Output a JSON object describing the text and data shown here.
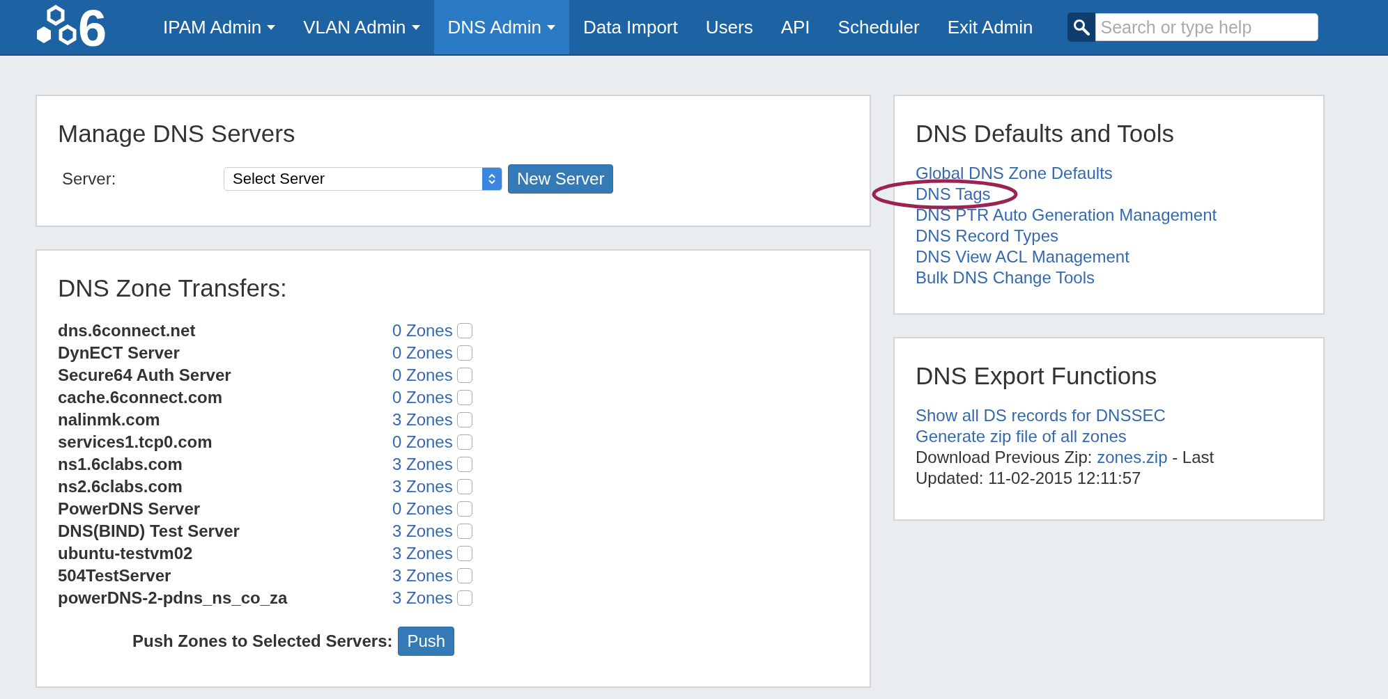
{
  "navbar": {
    "logo_text": "6",
    "items": [
      {
        "label": "IPAM Admin",
        "dropdown": true,
        "selected": false
      },
      {
        "label": "VLAN Admin",
        "dropdown": true,
        "selected": false
      },
      {
        "label": "DNS Admin",
        "dropdown": true,
        "selected": true
      },
      {
        "label": "Data Import",
        "dropdown": false,
        "selected": false
      },
      {
        "label": "Users",
        "dropdown": false,
        "selected": false
      },
      {
        "label": "API",
        "dropdown": false,
        "selected": false
      },
      {
        "label": "Scheduler",
        "dropdown": false,
        "selected": false
      },
      {
        "label": "Exit Admin",
        "dropdown": false,
        "selected": false
      }
    ],
    "search": {
      "placeholder": "Search or type help"
    }
  },
  "manage_servers": {
    "title": "Manage DNS Servers",
    "server_label": "Server:",
    "server_select": "Select Server",
    "new_button": "New Server"
  },
  "zone_transfers": {
    "title": "DNS Zone Transfers:",
    "rows": [
      {
        "server": "dns.6connect.net",
        "zones": "0 Zones",
        "checked": false
      },
      {
        "server": "DynECT Server",
        "zones": "0 Zones",
        "checked": false
      },
      {
        "server": "Secure64 Auth Server",
        "zones": "0 Zones",
        "checked": false
      },
      {
        "server": "cache.6connect.com",
        "zones": "0 Zones",
        "checked": false
      },
      {
        "server": "nalinmk.com",
        "zones": "3 Zones",
        "checked": false
      },
      {
        "server": "services1.tcp0.com",
        "zones": "0 Zones",
        "checked": false
      },
      {
        "server": "ns1.6clabs.com",
        "zones": "3 Zones",
        "checked": false
      },
      {
        "server": "ns2.6clabs.com",
        "zones": "3 Zones",
        "checked": false
      },
      {
        "server": "PowerDNS Server",
        "zones": "0 Zones",
        "checked": false
      },
      {
        "server": "DNS(BIND) Test Server",
        "zones": "3 Zones",
        "checked": false
      },
      {
        "server": "ubuntu-testvm02",
        "zones": "3 Zones",
        "checked": false
      },
      {
        "server": "504TestServer",
        "zones": "3 Zones",
        "checked": false
      },
      {
        "server": "powerDNS-2-pdns_ns_co_za",
        "zones": "3 Zones",
        "checked": false
      }
    ],
    "push_label": "Push Zones to Selected Servers:",
    "push_button": "Push"
  },
  "defaults_tools": {
    "title": "DNS Defaults and Tools",
    "links": [
      {
        "label": "Global DNS Zone Defaults",
        "circled": false
      },
      {
        "label": "DNS Tags",
        "circled": true
      },
      {
        "label": "DNS PTR Auto Generation Management",
        "circled": false
      },
      {
        "label": "DNS Record Types",
        "circled": false
      },
      {
        "label": "DNS View ACL Management",
        "circled": false
      },
      {
        "label": "Bulk DNS Change Tools",
        "circled": false
      }
    ]
  },
  "export_functions": {
    "title": "DNS Export Functions",
    "links": [
      "Show all DS records for DNSSEC",
      "Generate zip file of all zones"
    ],
    "download_prefix": "Download Previous Zip:",
    "download_link": "zones.zip",
    "download_suffix": "- Last",
    "updated": "Updated: 11-02-2015 12:11:57"
  }
}
